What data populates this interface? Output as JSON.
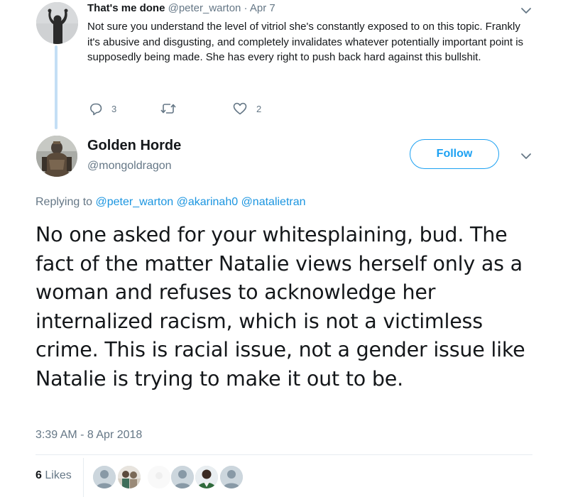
{
  "parent_tweet": {
    "author_name": "That's me done",
    "author_handle": "@peter_warton",
    "separator": "·",
    "date": "Apr 7",
    "text": "Not sure you understand the level of vitriol she's constantly exposed to on this topic. Frankly it's abusive and disgusting, and completely invalidates whatever potentially important point is supposedly being made. She has every right to push back hard against this bullshit.",
    "reply_count": "3",
    "retweet_count": "",
    "like_count": "2"
  },
  "main_tweet": {
    "author_name": "Golden Horde",
    "author_handle": "@mongoldragon",
    "follow_label": "Follow",
    "replying_prefix": "Replying to",
    "mentions": [
      "@peter_warton",
      "@akarinah0",
      "@natalietran"
    ],
    "text": "No one asked for your whitesplaining, bud. The fact of the matter Natalie views herself only as a woman and refuses to acknowledge her internalized racism, which is not a victimless crime. This is racial issue, not a gender issue like Natalie is trying to make it out to be.",
    "timestamp": "3:39 AM - 8 Apr 2018",
    "likes_count": "6",
    "likes_label": "Likes"
  },
  "colors": {
    "accent": "#1da1f2",
    "link": "#1b95e0",
    "secondary_text": "#657786",
    "primary_text": "#14171a",
    "thread_line": "#c4dff5",
    "divider": "#e6ecf0"
  },
  "icons": {
    "reply": "reply-icon",
    "retweet": "retweet-icon",
    "like": "heart-icon",
    "caret": "chevron-down-icon"
  }
}
